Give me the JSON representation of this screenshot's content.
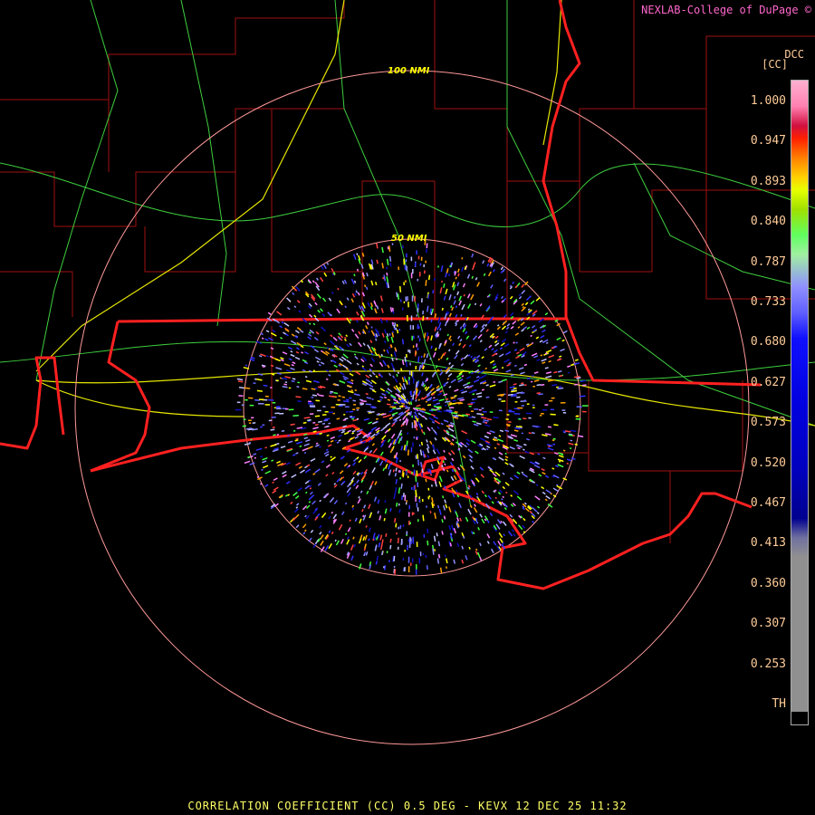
{
  "credit": "NEXLAB-College of DuPage ©",
  "product_code": "DCC",
  "units": "[CC]",
  "footer": "CORRELATION COEFFICIENT (CC) 0.5 DEG - KEVX 12 DEC 25 11:32",
  "range_rings": {
    "outer": "100 NMI",
    "inner": "50 NMI"
  },
  "legend_ticks": [
    "1.000",
    "0.947",
    "0.893",
    "0.840",
    "0.787",
    "0.733",
    "0.680",
    "0.627",
    "0.573",
    "0.520",
    "0.467",
    "0.413",
    "0.360",
    "0.307",
    "0.253",
    "TH"
  ],
  "colors": {
    "background": "#000000",
    "state_border": "#ff2020",
    "county_border": "#b01010",
    "highway": "#e6e600",
    "road": "#3ecf3e",
    "range_ring": "#ff9999",
    "legend_text": "#ffcc99",
    "footer_text": "#ffff66"
  }
}
